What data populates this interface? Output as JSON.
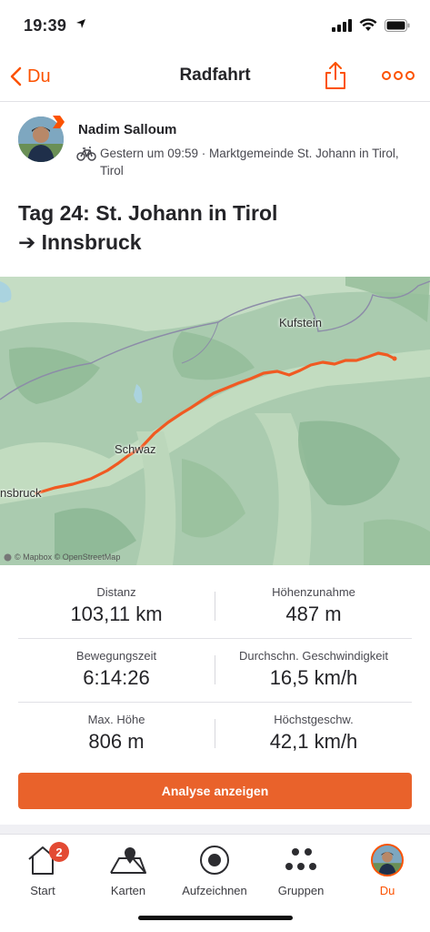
{
  "status_bar": {
    "time": "19:39"
  },
  "nav": {
    "back_label": "Du",
    "title": "Radfahrt"
  },
  "athlete": {
    "name": "Nadim Salloum",
    "meta": "Gestern um 09:59 · Marktgemeinde St. Johann in Tirol, Tirol"
  },
  "activity": {
    "title_line1": "Tag 24: St. Johann in Tirol",
    "title_line2": "➔ Innsbruck"
  },
  "map": {
    "labels": {
      "kufstein": "Kufstein",
      "schwaz": "Schwaz",
      "innsbruck": "nsbruck"
    },
    "attribution": "© Mapbox © OpenStreetMap",
    "route_color": "#f05a22"
  },
  "stats": [
    {
      "label": "Distanz",
      "value": "103,11 km"
    },
    {
      "label": "Höhenzunahme",
      "value": "487 m"
    },
    {
      "label": "Bewegungszeit",
      "value": "6:14:26"
    },
    {
      "label": "Durchschn. Geschwindigkeit",
      "value": "16,5 km/h"
    },
    {
      "label": "Max. Höhe",
      "value": "806 m"
    },
    {
      "label": "Höchstgeschw.",
      "value": "42,1 km/h"
    }
  ],
  "analysis_button": "Analyse anzeigen",
  "tabs": [
    {
      "label": "Start",
      "badge": "2",
      "icon": "home-icon"
    },
    {
      "label": "Karten",
      "icon": "map-icon"
    },
    {
      "label": "Aufzeichnen",
      "icon": "record-icon"
    },
    {
      "label": "Gruppen",
      "icon": "groups-icon"
    },
    {
      "label": "Du",
      "icon": "profile-avatar"
    }
  ],
  "colors": {
    "accent": "#fc5200",
    "button": "#e9622b",
    "badge": "#e34a33"
  }
}
